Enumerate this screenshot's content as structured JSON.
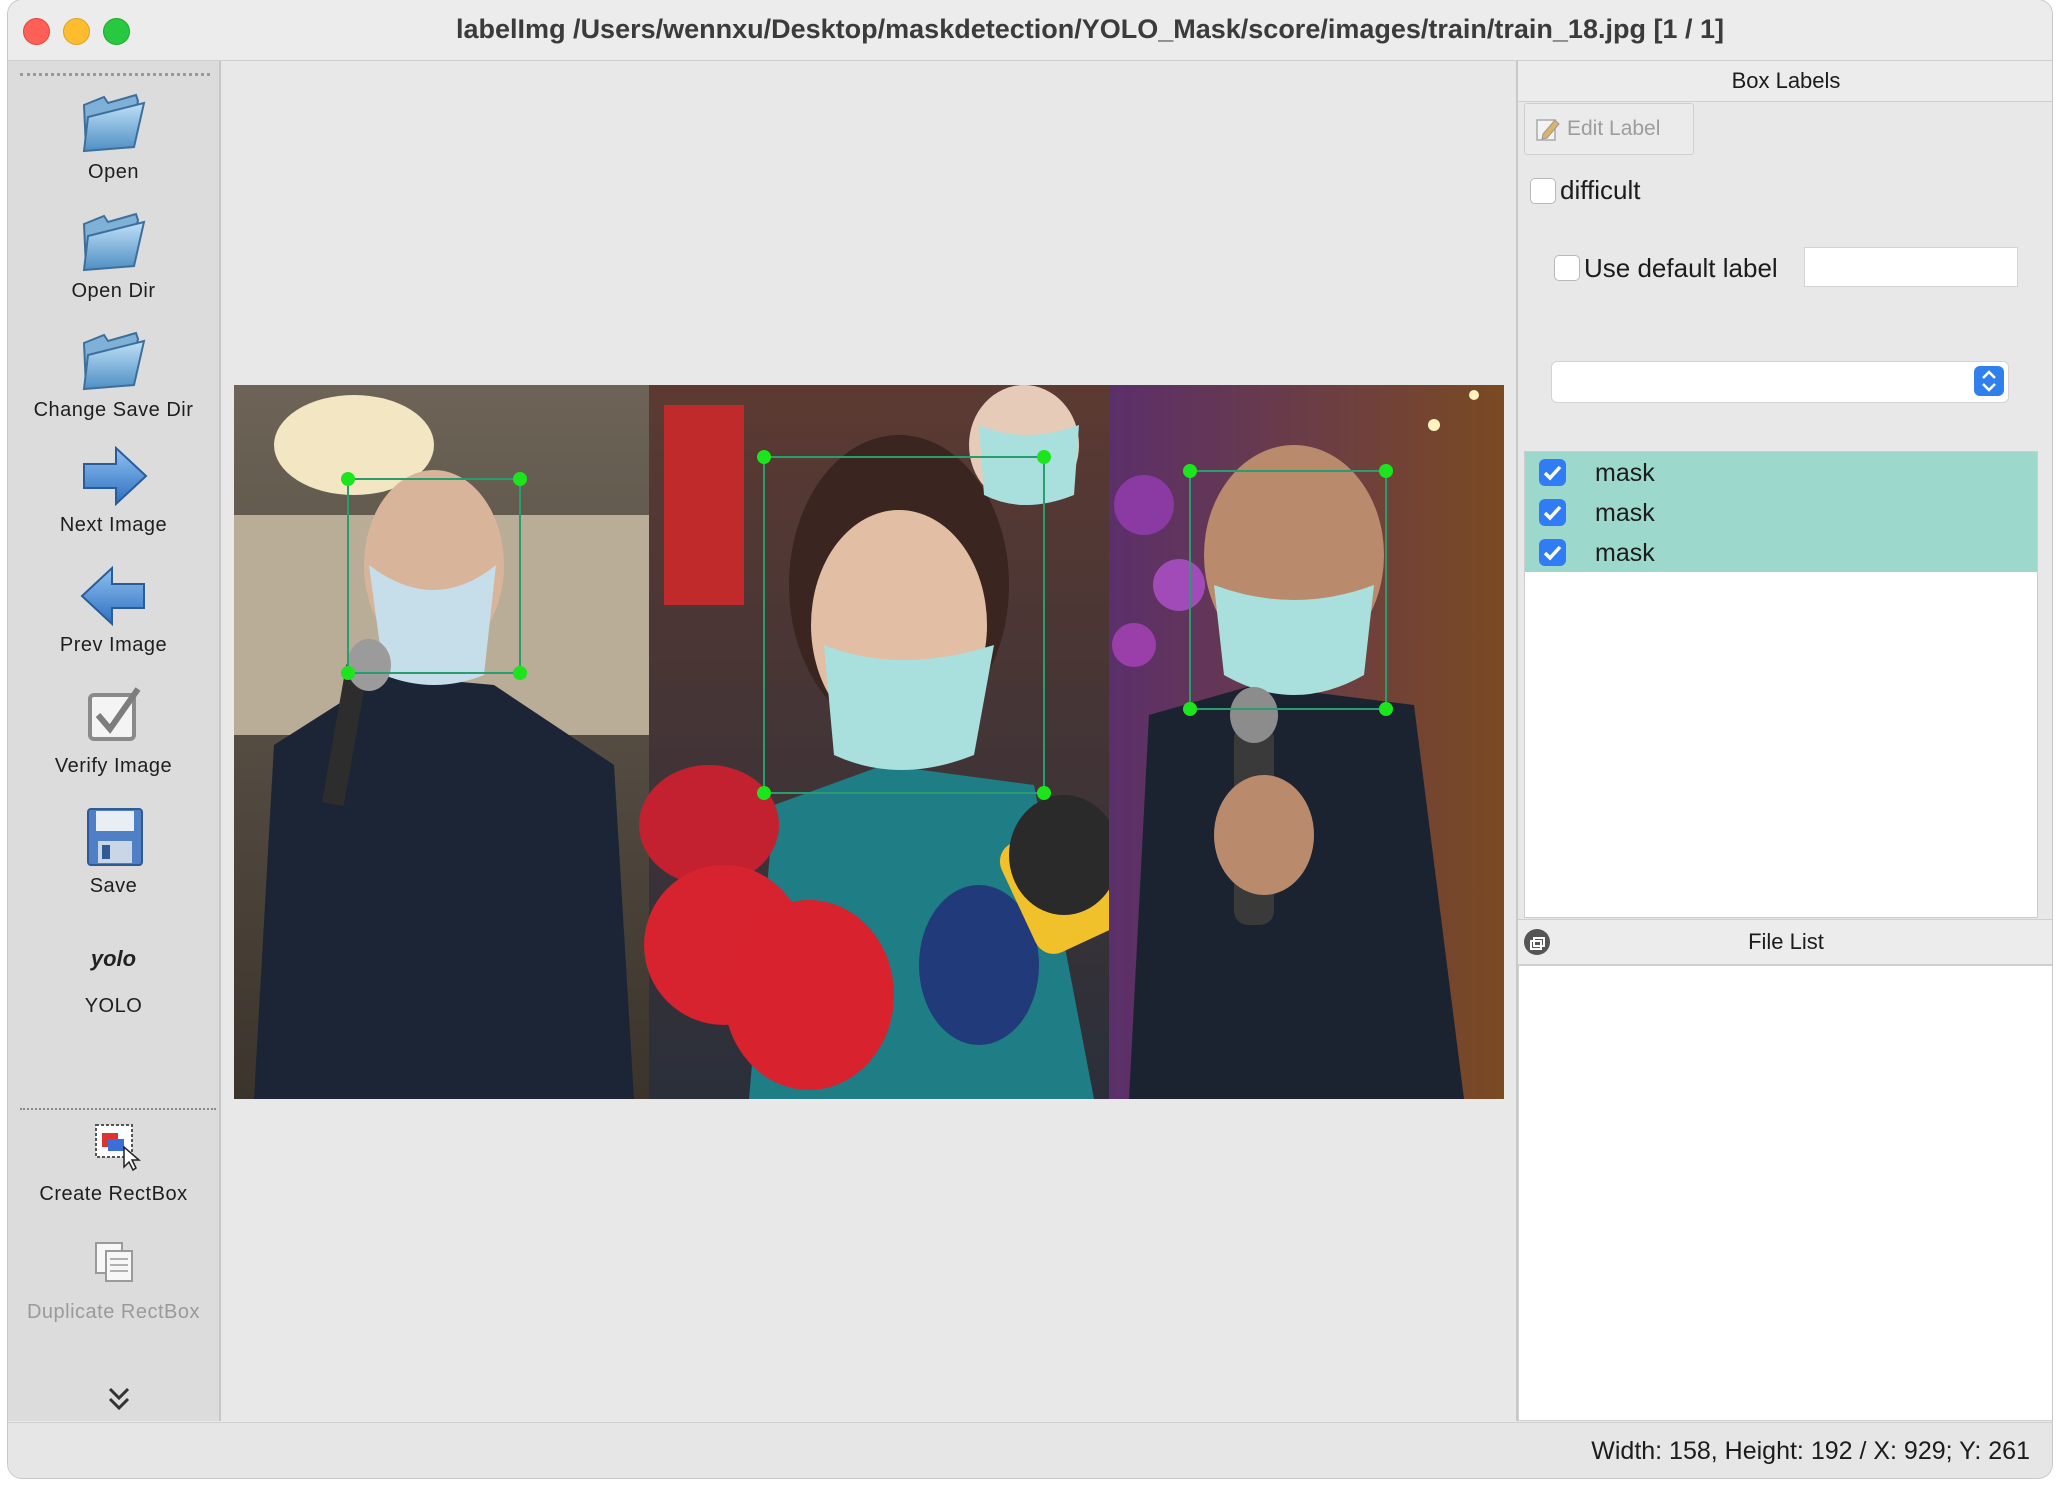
{
  "window": {
    "title": "labelImg /Users/wennxu/Desktop/maskdetection/YOLO_Mask/score/images/train/train_18.jpg [1 / 1]"
  },
  "toolbar": {
    "items": [
      {
        "label": "Open",
        "icon": "folder-open-icon"
      },
      {
        "label": "Open Dir",
        "icon": "folder-open-icon"
      },
      {
        "label": "Change Save Dir",
        "icon": "folder-open-icon"
      },
      {
        "label": "Next Image",
        "icon": "arrow-right-icon"
      },
      {
        "label": "Prev Image",
        "icon": "arrow-left-icon"
      },
      {
        "label": "Verify Image",
        "icon": "checkbox-icon"
      },
      {
        "label": "Save",
        "icon": "floppy-disk-icon"
      },
      {
        "label": "YOLO",
        "icon": "yolo-format-icon",
        "icon_text": "yolo"
      },
      {
        "label": "Create RectBox",
        "icon": "create-rect-icon"
      },
      {
        "label": "Duplicate RectBox",
        "icon": "duplicate-rect-icon"
      }
    ]
  },
  "box_labels": {
    "header": "Box Labels",
    "edit_label_button": "Edit Label",
    "difficult_label": "difficult",
    "difficult_checked": false,
    "use_default_label": "Use default label",
    "use_default_checked": false,
    "default_label_value": "",
    "combo_value": "",
    "labels": [
      {
        "text": "mask",
        "checked": true
      },
      {
        "text": "mask",
        "checked": true
      },
      {
        "text": "mask",
        "checked": true
      }
    ]
  },
  "file_list": {
    "header": "File List"
  },
  "status": {
    "text": "Width: 158, Height: 192 / X: 929; Y: 261"
  },
  "colors": {
    "box_outline": "#2a9d6f",
    "box_handle": "#1de51d",
    "label_selection": "#9dd8cc",
    "checkbox_blue": "#2f7cf6"
  }
}
